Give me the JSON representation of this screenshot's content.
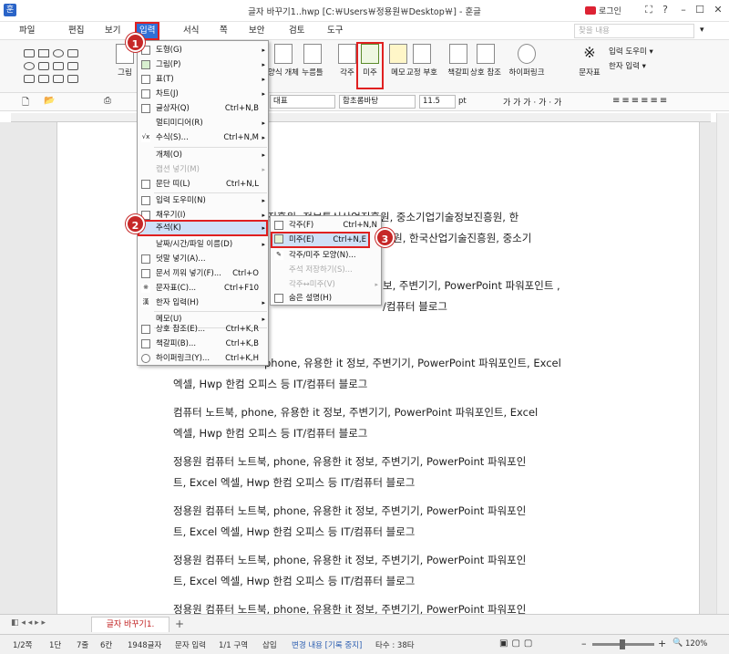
{
  "window": {
    "title": "글자 바꾸기1..hwp [C:￦Users￦정용원￦Desktop￦] - 훈글",
    "login": "로그인",
    "app_icon_label": "훈"
  },
  "menubar": {
    "items": [
      "파일",
      "편집",
      "보기",
      "입력",
      "서식",
      "쪽",
      "보안",
      "검토",
      "도구"
    ],
    "active": "입력",
    "search_placeholder": "찾을 내용"
  },
  "ribbon": {
    "left_label": "그림",
    "buttons": [
      {
        "label": "양식 개체"
      },
      {
        "label": "누름틀"
      },
      {
        "label": "각주"
      },
      {
        "label": "미주"
      },
      {
        "label": "메모"
      },
      {
        "label": "교정 부호"
      },
      {
        "label": "책갈피"
      },
      {
        "label": "상호 참조"
      },
      {
        "label": "하이퍼링크"
      },
      {
        "label": "문자표"
      }
    ],
    "side_items": [
      "입력 도우미",
      "한자 입력"
    ]
  },
  "format_bar": {
    "style": "대표",
    "font": "함초롬바탕",
    "size": "11.5",
    "unit": "pt"
  },
  "input_menu": {
    "items": [
      {
        "label": "도형(G)",
        "shortcut": "",
        "arrow": true,
        "icon": "shape-icon"
      },
      {
        "label": "그림(P)",
        "shortcut": "",
        "arrow": true,
        "icon": "picture-icon"
      },
      {
        "label": "표(T)",
        "shortcut": "",
        "arrow": true,
        "icon": "table-icon"
      },
      {
        "label": "차트(J)",
        "shortcut": "",
        "arrow": true,
        "icon": "chart-icon"
      },
      {
        "label": "글상자(Q)",
        "shortcut": "Ctrl+N,B",
        "arrow": false,
        "icon": "textbox-icon"
      },
      {
        "label": "멀티미디어(R)",
        "shortcut": "",
        "arrow": true,
        "icon": ""
      },
      {
        "label": "수식(S)...",
        "shortcut": "Ctrl+N,M",
        "arrow": true,
        "icon": "formula-icon"
      },
      {
        "label": "개체(O)",
        "shortcut": "",
        "arrow": true,
        "icon": ""
      },
      {
        "label": "캡션 넣기(M)",
        "shortcut": "",
        "arrow": true,
        "icon": "",
        "disabled": true
      },
      {
        "label": "문단 띠(L)",
        "shortcut": "Ctrl+N,L",
        "arrow": false,
        "icon": "paragraph-band-icon"
      },
      {
        "label": "입력 도우미(N)",
        "shortcut": "",
        "arrow": true,
        "icon": "input-helper-icon"
      },
      {
        "label": "채우기(I)",
        "shortcut": "",
        "arrow": true,
        "icon": "fill-icon"
      },
      {
        "label": "주석(K)",
        "shortcut": "",
        "arrow": true,
        "icon": "",
        "highlighted": true
      },
      {
        "label": "날짜/시간/파일 이름(D)",
        "shortcut": "",
        "arrow": true,
        "icon": ""
      },
      {
        "label": "덧말 넣기(A)...",
        "shortcut": "",
        "arrow": false,
        "icon": "ruby-text-icon"
      },
      {
        "label": "문서 끼워 넣기(F)...",
        "shortcut": "Ctrl+O",
        "arrow": false,
        "icon": "insert-doc-icon"
      },
      {
        "label": "문자표(C)...",
        "shortcut": "Ctrl+F10",
        "arrow": false,
        "icon": "symbol-icon"
      },
      {
        "label": "한자 입력(H)",
        "shortcut": "",
        "arrow": true,
        "icon": "hanja-icon"
      },
      {
        "label": "메모(U)",
        "shortcut": "",
        "arrow": true,
        "icon": ""
      },
      {
        "label": "상호 참조(E)...",
        "shortcut": "Ctrl+K,R",
        "arrow": false,
        "icon": "crossref-icon"
      },
      {
        "label": "책갈피(B)...",
        "shortcut": "Ctrl+K,B",
        "arrow": false,
        "icon": "bookmark-icon"
      },
      {
        "label": "하이퍼링크(Y)...",
        "shortcut": "Ctrl+K,H",
        "arrow": false,
        "icon": "hyperlink-icon"
      }
    ]
  },
  "note_submenu": {
    "items": [
      {
        "label": "각주(F)",
        "shortcut": "Ctrl+N,N",
        "icon": "footnote-icon"
      },
      {
        "label": "미주(E)",
        "shortcut": "Ctrl+N,E",
        "icon": "endnote-icon",
        "highlighted": true
      },
      {
        "label": "각주/미주 모양(N)...",
        "shortcut": "",
        "icon": "note-shape-icon"
      },
      {
        "label": "주석 저장하기(S)...",
        "shortcut": "",
        "icon": "",
        "disabled": true
      },
      {
        "label": "각주↔미주(V)",
        "shortcut": "",
        "icon": "",
        "disabled": true,
        "arrow": true
      },
      {
        "label": "숨은 설명(H)",
        "shortcut": "",
        "icon": "hidden-note-icon"
      }
    ]
  },
  "badges": [
    "1",
    "2",
    "3"
  ],
  "document": {
    "partial": [
      "1진흥원, 정보통신산업진흥원, 중소기업기술정보진흥원, 한",
      "진흥원, 한국산업기술진흥원, 중소기",
      "보, 주변기기, PowerPoint 파워포인트 ,",
      "/컴퓨터 블로그"
    ],
    "paragraphs": [
      {
        "line1": "phone, 유용한 it 정보, 주변기기, PowerPoint 파워포인트, Excel",
        "line2": "엑셀, Hwp 한컴 오피스 등 IT/컴퓨터 블로그"
      },
      {
        "line1": "컴퓨터 노트북, phone, 유용한 it 정보, 주변기기, PowerPoint 파워포인트, Excel",
        "line2": "엑셀, Hwp 한컴 오피스 등 IT/컴퓨터 블로그"
      },
      {
        "line1": "정용원 컴퓨터 노트북, phone, 유용한 it 정보, 주변기기, PowerPoint 파워포인",
        "line2": "트, Excel 엑셀, Hwp 한컴 오피스 등 IT/컴퓨터 블로그"
      },
      {
        "line1": "정용원 컴퓨터 노트북, phone, 유용한 it 정보, 주변기기, PowerPoint 파워포인",
        "line2": "트, Excel 엑셀, Hwp 한컴 오피스 등 IT/컴퓨터 블로그"
      },
      {
        "line1": "정용원 컴퓨터 노트북, phone, 유용한 it 정보, 주변기기, PowerPoint 파워포인",
        "line2": "트, Excel 엑셀, Hwp 한컴 오피스 등 IT/컴퓨터 블로그"
      },
      {
        "line1": "정용원 컴퓨터 노트북, phone, 유용한 it 정보, 주변기기, PowerPoint 파워포인",
        "line2": ""
      }
    ]
  },
  "tab": {
    "label": "글자 바꾸기1."
  },
  "status": {
    "page": "1/2쪽",
    "col": "1단",
    "line": "7줄",
    "char": "6칸",
    "count": "1948글자",
    "mode": "문자 입력",
    "section": "1/1 구역",
    "insert": "삽입",
    "track": "변경 내용 [기록 중지]",
    "typing": "타수 : 38타",
    "zoom": "120%"
  }
}
